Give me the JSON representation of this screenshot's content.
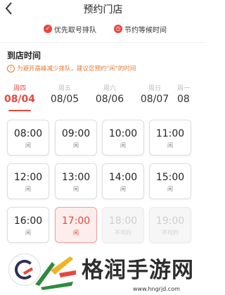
{
  "header": {
    "title": "预约门店",
    "back_icon": "chevron-left-icon"
  },
  "badges": [
    {
      "icon": "priority-icon",
      "label": "优先取号排队"
    },
    {
      "icon": "clock-icon",
      "label": "节约等候时间"
    }
  ],
  "section": {
    "title": "到店时间",
    "notice": "为避开高峰减少排队，建议您预约\"闲\"的时间"
  },
  "days": [
    {
      "weekday": "周四",
      "date": "08/04",
      "active": true
    },
    {
      "weekday": "周五",
      "date": "08/05",
      "active": false
    },
    {
      "weekday": "周六",
      "date": "08/06",
      "active": false
    },
    {
      "weekday": "周日",
      "date": "08/07",
      "active": false
    },
    {
      "weekday": "周一",
      "date": "08",
      "active": false
    }
  ],
  "slots": [
    {
      "time": "08:00",
      "status": "闲",
      "state": "normal"
    },
    {
      "time": "09:00",
      "status": "闲",
      "state": "normal"
    },
    {
      "time": "10:00",
      "status": "闲",
      "state": "normal"
    },
    {
      "time": "11:00",
      "status": "闲",
      "state": "normal"
    },
    {
      "time": "12:00",
      "status": "闲",
      "state": "normal"
    },
    {
      "time": "13:00",
      "status": "闲",
      "state": "normal"
    },
    {
      "time": "14:00",
      "status": "闲",
      "state": "normal"
    },
    {
      "time": "15:00",
      "status": "闲",
      "state": "normal"
    },
    {
      "time": "16:00",
      "status": "闲",
      "state": "normal"
    },
    {
      "time": "17:00",
      "status": "闲",
      "state": "selected"
    },
    {
      "time": "18:00",
      "status": "不可约",
      "state": "disabled"
    },
    {
      "time": "19:00",
      "status": "不可约",
      "state": "disabled"
    }
  ],
  "watermark": {
    "text": "格润手游网",
    "url": "www.hngrjd.com"
  },
  "colors": {
    "accent": "#e8463d",
    "notice": "#e07a35",
    "navy": "#2e2e55"
  }
}
